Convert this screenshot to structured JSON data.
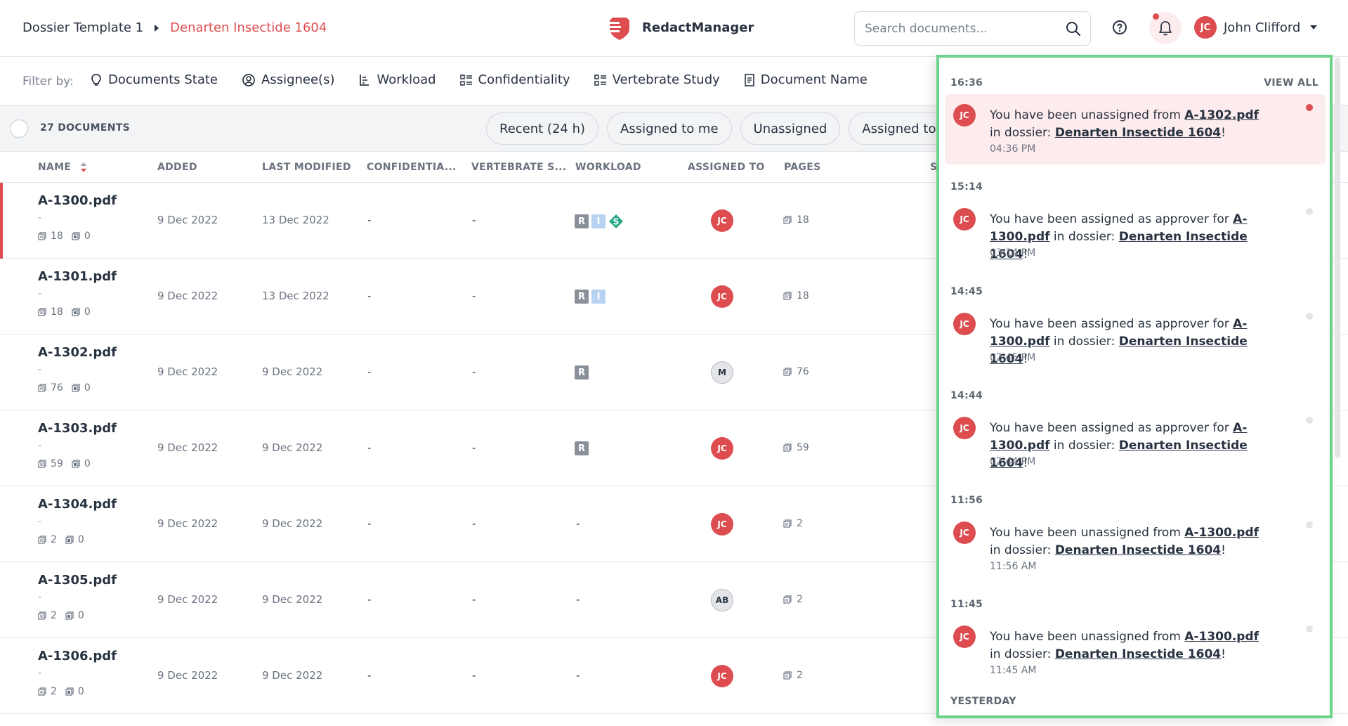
{
  "header": {
    "breadcrumb_root": "Dossier Template 1",
    "breadcrumb_current": "Denarten Insectide 1604",
    "brand_name": "RedactManager",
    "search_placeholder": "Search documents...",
    "user_initials": "JC",
    "user_name": "John Clifford"
  },
  "filters": {
    "label": "Filter by:",
    "items": [
      "Documents State",
      "Assignee(s)",
      "Workload",
      "Confidentiality",
      "Vertebrate Study",
      "Document Name"
    ]
  },
  "toolbar": {
    "doc_count": "27 DOCUMENTS",
    "quick_filters": [
      "Recent (24 h)",
      "Assigned to me",
      "Unassigned",
      "Assigned to oth"
    ]
  },
  "columns": [
    "NAME",
    "ADDED",
    "LAST MODIFIED",
    "CONFIDENTIA...",
    "VERTEBRATE S...",
    "WORKLOAD",
    "ASSIGNED TO",
    "PAGES",
    "S"
  ],
  "rows": [
    {
      "name": "A-1300.pdf",
      "sub": "-",
      "pages_count": "18",
      "ann_count": "0",
      "added": "9 Dec 2022",
      "modified": "13 Dec 2022",
      "confidentiality": "-",
      "vertebrate": "-",
      "workload": [
        "R",
        "I",
        "S"
      ],
      "workload_dash": "",
      "assignee": "JC",
      "assignee_style": "red",
      "pages": "18"
    },
    {
      "name": "A-1301.pdf",
      "sub": "-",
      "pages_count": "18",
      "ann_count": "0",
      "added": "9 Dec 2022",
      "modified": "13 Dec 2022",
      "confidentiality": "-",
      "vertebrate": "-",
      "workload": [
        "R",
        "I"
      ],
      "workload_dash": "",
      "assignee": "JC",
      "assignee_style": "red",
      "pages": "18"
    },
    {
      "name": "A-1302.pdf",
      "sub": "-",
      "pages_count": "76",
      "ann_count": "0",
      "added": "9 Dec 2022",
      "modified": "9 Dec 2022",
      "confidentiality": "-",
      "vertebrate": "-",
      "workload": [
        "R"
      ],
      "workload_dash": "",
      "assignee": "M",
      "assignee_style": "gray",
      "pages": "76"
    },
    {
      "name": "A-1303.pdf",
      "sub": "-",
      "pages_count": "59",
      "ann_count": "0",
      "added": "9 Dec 2022",
      "modified": "9 Dec 2022",
      "confidentiality": "-",
      "vertebrate": "-",
      "workload": [
        "R"
      ],
      "workload_dash": "",
      "assignee": "JC",
      "assignee_style": "red",
      "pages": "59"
    },
    {
      "name": "A-1304.pdf",
      "sub": "-",
      "pages_count": "2",
      "ann_count": "0",
      "added": "9 Dec 2022",
      "modified": "9 Dec 2022",
      "confidentiality": "-",
      "vertebrate": "-",
      "workload": [],
      "workload_dash": "-",
      "assignee": "JC",
      "assignee_style": "red",
      "pages": "2"
    },
    {
      "name": "A-1305.pdf",
      "sub": "-",
      "pages_count": "2",
      "ann_count": "0",
      "added": "9 Dec 2022",
      "modified": "9 Dec 2022",
      "confidentiality": "-",
      "vertebrate": "-",
      "workload": [],
      "workload_dash": "-",
      "assignee": "AB",
      "assignee_style": "gray",
      "pages": "2"
    },
    {
      "name": "A-1306.pdf",
      "sub": "-",
      "pages_count": "2",
      "ann_count": "0",
      "added": "9 Dec 2022",
      "modified": "9 Dec 2022",
      "confidentiality": "-",
      "vertebrate": "-",
      "workload": [],
      "workload_dash": "-",
      "assignee": "JC",
      "assignee_style": "red",
      "pages": "2"
    }
  ],
  "notifications": {
    "view_all": "VIEW ALL",
    "groups": [
      {
        "time": "16:36",
        "initials": "JC",
        "pre": "You have been unassigned from ",
        "file": "A-1302.pdf",
        "mid": " in dossier: ",
        "dossier": "Denarten Insectide 1604",
        "post": "!",
        "stamp": "04:36 PM",
        "unread": true
      },
      {
        "time": "15:14",
        "initials": "JC",
        "pre": "You have been assigned as approver for ",
        "file": "A-1300.pdf",
        "mid": " in dossier: ",
        "dossier": "Denarten Insectide 1604",
        "post": "!",
        "stamp": "03:14 PM",
        "unread": false
      },
      {
        "time": "14:45",
        "initials": "JC",
        "pre": "You have been assigned as approver for ",
        "file": "A-1300.pdf",
        "mid": " in dossier: ",
        "dossier": "Denarten Insectide 1604",
        "post": "!",
        "stamp": "02:45 PM",
        "unread": false
      },
      {
        "time": "14:44",
        "initials": "JC",
        "pre": "You have been assigned as approver for ",
        "file": "A-1300.pdf",
        "mid": " in dossier: ",
        "dossier": "Denarten Insectide 1604",
        "post": "!",
        "stamp": "02:44 PM",
        "unread": false
      },
      {
        "time": "11:56",
        "initials": "JC",
        "pre": "You have been unassigned from ",
        "file": "A-1300.pdf",
        "mid": " in dossier: ",
        "dossier": "Denarten Insectide 1604",
        "post": "!",
        "stamp": "11:56 AM",
        "unread": false
      },
      {
        "time": "11:45",
        "initials": "JC",
        "pre": "You have been unassigned from ",
        "file": "A-1300.pdf",
        "mid": " in dossier: ",
        "dossier": "Denarten Insectide 1604",
        "post": "!",
        "stamp": "11:45 AM",
        "unread": false
      }
    ],
    "next_group": "YESTERDAY"
  },
  "colors": {
    "accent": "#dd4d50",
    "highlight_border": "#6ad48a",
    "workload_s": "#2aa889"
  }
}
